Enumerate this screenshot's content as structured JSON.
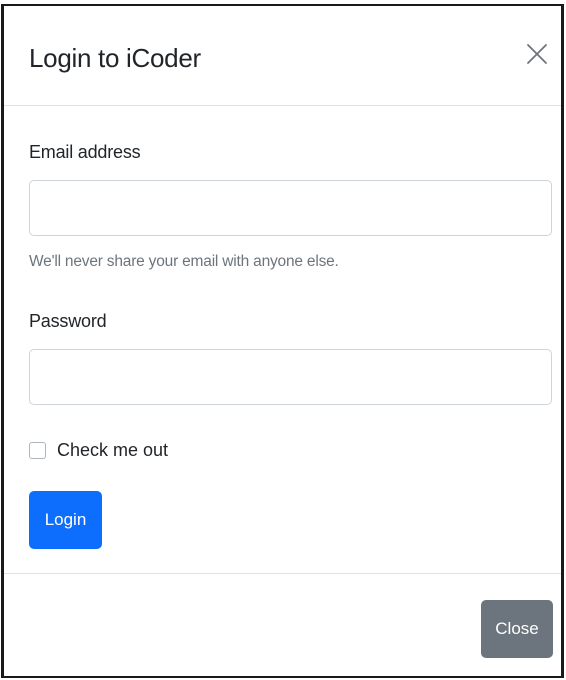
{
  "modal": {
    "title": "Login to iCoder",
    "close_icon": "close-x-icon"
  },
  "form": {
    "email_label": "Email address",
    "email_value": "",
    "email_help": "We'll never share your email with anyone else.",
    "password_label": "Password",
    "password_value": "",
    "checkbox_label": "Check me out",
    "checkbox_checked": false,
    "submit_label": "Login"
  },
  "footer": {
    "close_label": "Close"
  },
  "colors": {
    "primary": "#0d6efd",
    "secondary": "#6c757d",
    "muted_text": "#6c757d",
    "border": "#ced4da"
  }
}
